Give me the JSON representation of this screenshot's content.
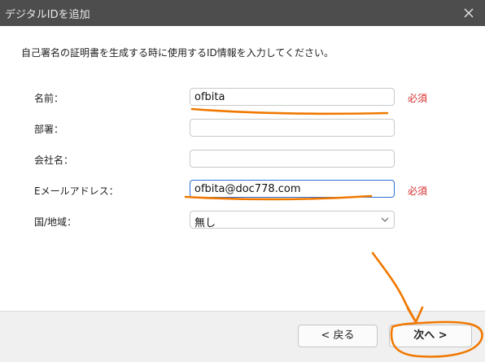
{
  "window": {
    "title": "デジタルIDを追加",
    "close_icon": "close-icon"
  },
  "instruction": "自己署名の証明書を生成する時に使用するID情報を入力してください。",
  "form": {
    "name": {
      "label": "名前：",
      "value": "ofbita",
      "required_label": "必須"
    },
    "department": {
      "label": "部署：",
      "value": ""
    },
    "company": {
      "label": "会社名：",
      "value": ""
    },
    "email": {
      "label": "Eメールアドレス：",
      "value": "ofbita@doc778.com",
      "required_label": "必須"
    },
    "country": {
      "label": "国/地域：",
      "selected": "無し"
    }
  },
  "buttons": {
    "back": "< 戻る",
    "next": "次へ >"
  },
  "colors": {
    "titlebar": "#4d4d4d",
    "required": "#d62b2b",
    "annotation": "#f07800",
    "focus_border": "#2f6fd6"
  }
}
